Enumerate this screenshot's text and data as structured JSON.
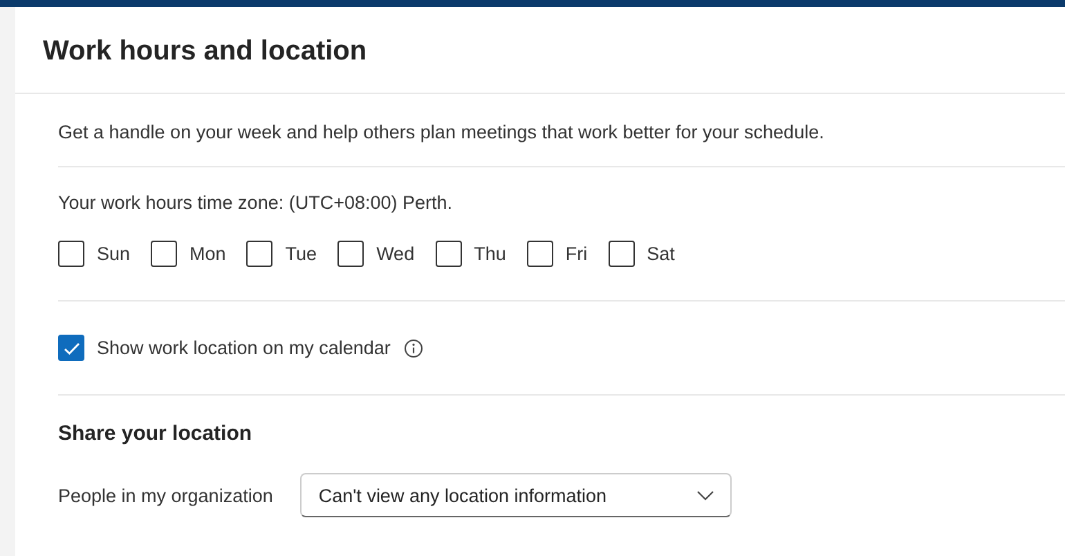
{
  "title": "Work hours and location",
  "description": "Get a handle on your week and help others plan meetings that work better for your schedule.",
  "time_zone": "Your work hours time zone: (UTC+08:00) Perth.",
  "days": [
    {
      "label": "Sun",
      "checked": false
    },
    {
      "label": "Mon",
      "checked": false
    },
    {
      "label": "Tue",
      "checked": false
    },
    {
      "label": "Wed",
      "checked": false
    },
    {
      "label": "Thu",
      "checked": false
    },
    {
      "label": "Fri",
      "checked": false
    },
    {
      "label": "Sat",
      "checked": false
    }
  ],
  "show_location": {
    "label": "Show work location on my calendar",
    "checked": true
  },
  "share": {
    "heading": "Share your location",
    "label": "People in my organization",
    "value": "Can't view any location information"
  }
}
